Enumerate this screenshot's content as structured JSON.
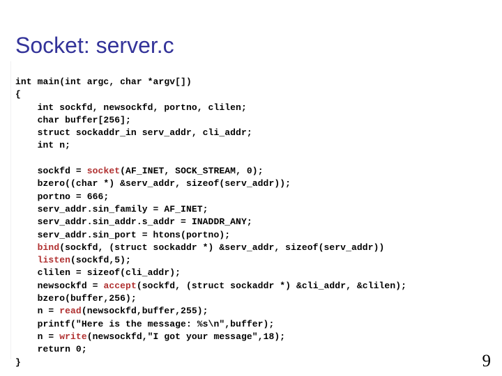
{
  "slide": {
    "title": "Socket: server.c",
    "title_color": "#333399",
    "page_number": "9",
    "background_color": "#ffffff",
    "code_text_color": "#000000",
    "code_keyword_color": "#b03030"
  },
  "code": {
    "language": "c",
    "highlighted_functions": [
      "socket",
      "bind",
      "listen",
      "accept",
      "read",
      "write"
    ],
    "lines": [
      {
        "indent": 0,
        "segments": [
          {
            "t": "int main(int argc, char *argv[])",
            "kw": false
          }
        ]
      },
      {
        "indent": 0,
        "segments": [
          {
            "t": "{",
            "kw": false
          }
        ]
      },
      {
        "indent": 1,
        "segments": [
          {
            "t": "int sockfd, newsockfd, portno, clilen;",
            "kw": false
          }
        ]
      },
      {
        "indent": 1,
        "segments": [
          {
            "t": "char buffer[256];",
            "kw": false
          }
        ]
      },
      {
        "indent": 1,
        "segments": [
          {
            "t": "struct sockaddr_in serv_addr, cli_addr;",
            "kw": false
          }
        ]
      },
      {
        "indent": 1,
        "segments": [
          {
            "t": "int n;",
            "kw": false
          }
        ]
      },
      {
        "indent": 0,
        "blank": true,
        "segments": []
      },
      {
        "indent": 1,
        "segments": [
          {
            "t": "sockfd = ",
            "kw": false
          },
          {
            "t": "socket",
            "kw": true
          },
          {
            "t": "(AF_INET, SOCK_STREAM, 0);",
            "kw": false
          }
        ]
      },
      {
        "indent": 1,
        "segments": [
          {
            "t": "bzero((char *) &serv_addr, sizeof(serv_addr));",
            "kw": false
          }
        ]
      },
      {
        "indent": 1,
        "segments": [
          {
            "t": "portno = 666;",
            "kw": false
          }
        ]
      },
      {
        "indent": 1,
        "segments": [
          {
            "t": "serv_addr.sin_family = AF_INET;",
            "kw": false
          }
        ]
      },
      {
        "indent": 1,
        "segments": [
          {
            "t": "serv_addr.sin_addr.s_addr = INADDR_ANY;",
            "kw": false
          }
        ]
      },
      {
        "indent": 1,
        "segments": [
          {
            "t": "serv_addr.sin_port = htons(portno);",
            "kw": false
          }
        ]
      },
      {
        "indent": 1,
        "segments": [
          {
            "t": "bind",
            "kw": true
          },
          {
            "t": "(sockfd, (struct sockaddr *) &serv_addr, sizeof(serv_addr))",
            "kw": false
          }
        ]
      },
      {
        "indent": 1,
        "segments": [
          {
            "t": "listen",
            "kw": true
          },
          {
            "t": "(sockfd,5);",
            "kw": false
          }
        ]
      },
      {
        "indent": 1,
        "segments": [
          {
            "t": "clilen = sizeof(cli_addr);",
            "kw": false
          }
        ]
      },
      {
        "indent": 1,
        "segments": [
          {
            "t": "newsockfd = ",
            "kw": false
          },
          {
            "t": "accept",
            "kw": true
          },
          {
            "t": "(sockfd, (struct sockaddr *) &cli_addr, &clilen);",
            "kw": false
          }
        ]
      },
      {
        "indent": 1,
        "segments": [
          {
            "t": "bzero(buffer,256);",
            "kw": false
          }
        ]
      },
      {
        "indent": 1,
        "segments": [
          {
            "t": "n = ",
            "kw": false
          },
          {
            "t": "read",
            "kw": true
          },
          {
            "t": "(newsockfd,buffer,255);",
            "kw": false
          }
        ]
      },
      {
        "indent": 1,
        "segments": [
          {
            "t": "printf(\"Here is the message: %s\\n\",buffer);",
            "kw": false
          }
        ]
      },
      {
        "indent": 1,
        "segments": [
          {
            "t": "n = ",
            "kw": false
          },
          {
            "t": "write",
            "kw": true
          },
          {
            "t": "(newsockfd,\"I got your message\",18);",
            "kw": false
          }
        ]
      },
      {
        "indent": 1,
        "segments": [
          {
            "t": "return 0;",
            "kw": false
          }
        ]
      },
      {
        "indent": 0,
        "segments": [
          {
            "t": "}",
            "kw": false
          }
        ]
      }
    ]
  }
}
